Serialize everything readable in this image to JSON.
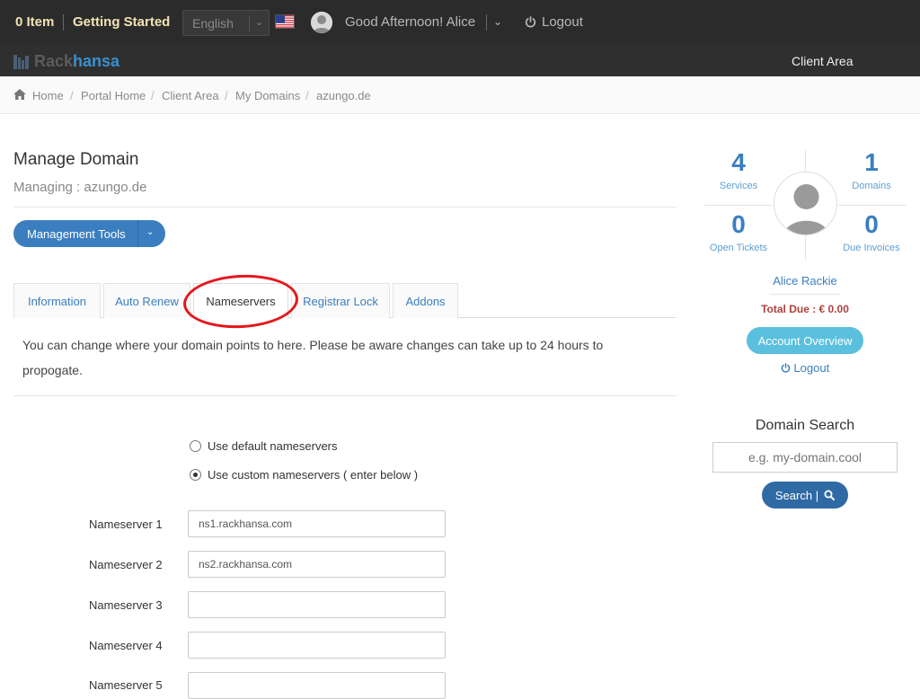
{
  "topbar": {
    "cart_label": "0 Item",
    "getting_started": "Getting Started",
    "language_selected": "English",
    "greeting": "Good Afternoon! Alice",
    "logout_label": "Logout"
  },
  "brand": {
    "logo_part1": "Rack",
    "logo_part2": "hansa",
    "logo_accent": "#3a8fd0",
    "nav_client_area": "Client Area"
  },
  "breadcrumb": [
    "Home",
    "Portal Home",
    "Client Area",
    "My Domains",
    "azungo.de"
  ],
  "main": {
    "title": "Manage Domain",
    "subtitle": "Managing : azungo.de",
    "management_tools": "Management Tools",
    "tabs": [
      {
        "label": "Information",
        "active": false
      },
      {
        "label": "Auto Renew",
        "active": false
      },
      {
        "label": "Nameservers",
        "active": true
      },
      {
        "label": "Registrar Lock",
        "active": false
      },
      {
        "label": "Addons",
        "active": false
      }
    ],
    "description": "You can change where your domain points to here. Please be aware changes can take up to 24 hours to propogate.",
    "radio_default": "Use default nameservers",
    "radio_custom": "Use custom nameservers ( enter below )",
    "selected_option": "custom",
    "nameservers": [
      {
        "label": "Nameserver 1",
        "value": "ns1.rackhansa.com"
      },
      {
        "label": "Nameserver 2",
        "value": "ns2.rackhansa.com"
      },
      {
        "label": "Nameserver 3",
        "value": ""
      },
      {
        "label": "Nameserver 4",
        "value": ""
      },
      {
        "label": "Nameserver 5",
        "value": ""
      }
    ]
  },
  "sidebar": {
    "stats": [
      {
        "num": "4",
        "label": "Services"
      },
      {
        "num": "1",
        "label": "Domains"
      },
      {
        "num": "0",
        "label": "Open Tickets"
      },
      {
        "num": "0",
        "label": "Due Invoices"
      }
    ],
    "user_name": "Alice Rackie",
    "total_due": "Total Due : € 0.00",
    "account_overview": "Account Overview",
    "logout": "Logout",
    "domain_search_title": "Domain Search",
    "domain_search_placeholder": "e.g. my-domain.cool",
    "search_button": "Search |"
  },
  "colors": {
    "primary": "#3b7ec0",
    "info": "#5bc0de",
    "danger_text": "#b0413e",
    "highlight_circle": "#e5161a"
  }
}
